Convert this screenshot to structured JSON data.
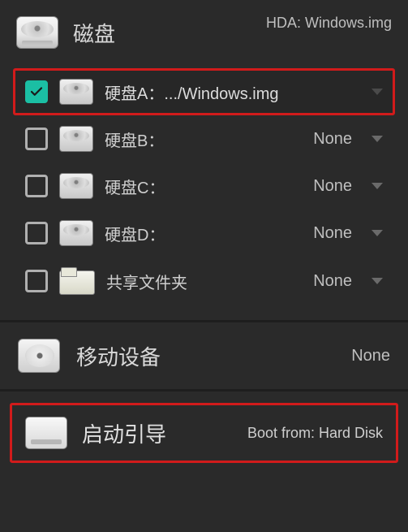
{
  "sections": {
    "disk": {
      "title": "磁盘",
      "hint": "HDA: Windows.img",
      "rows": [
        {
          "checked": true,
          "highlight": true,
          "icon": "hdd",
          "label": "硬盘A：.../Windows.img",
          "value": ""
        },
        {
          "checked": false,
          "highlight": false,
          "icon": "hdd",
          "label": "硬盘B：",
          "value": "None"
        },
        {
          "checked": false,
          "highlight": false,
          "icon": "hdd",
          "label": "硬盘C：",
          "value": "None"
        },
        {
          "checked": false,
          "highlight": false,
          "icon": "hdd",
          "label": "硬盘D：",
          "value": "None"
        },
        {
          "checked": false,
          "highlight": false,
          "icon": "folder",
          "label": "共享文件夹",
          "value": "None"
        }
      ]
    },
    "removable": {
      "title": "移动设备",
      "value": "None"
    },
    "boot": {
      "title": "启动引导",
      "value": "Boot from: Hard Disk"
    }
  }
}
